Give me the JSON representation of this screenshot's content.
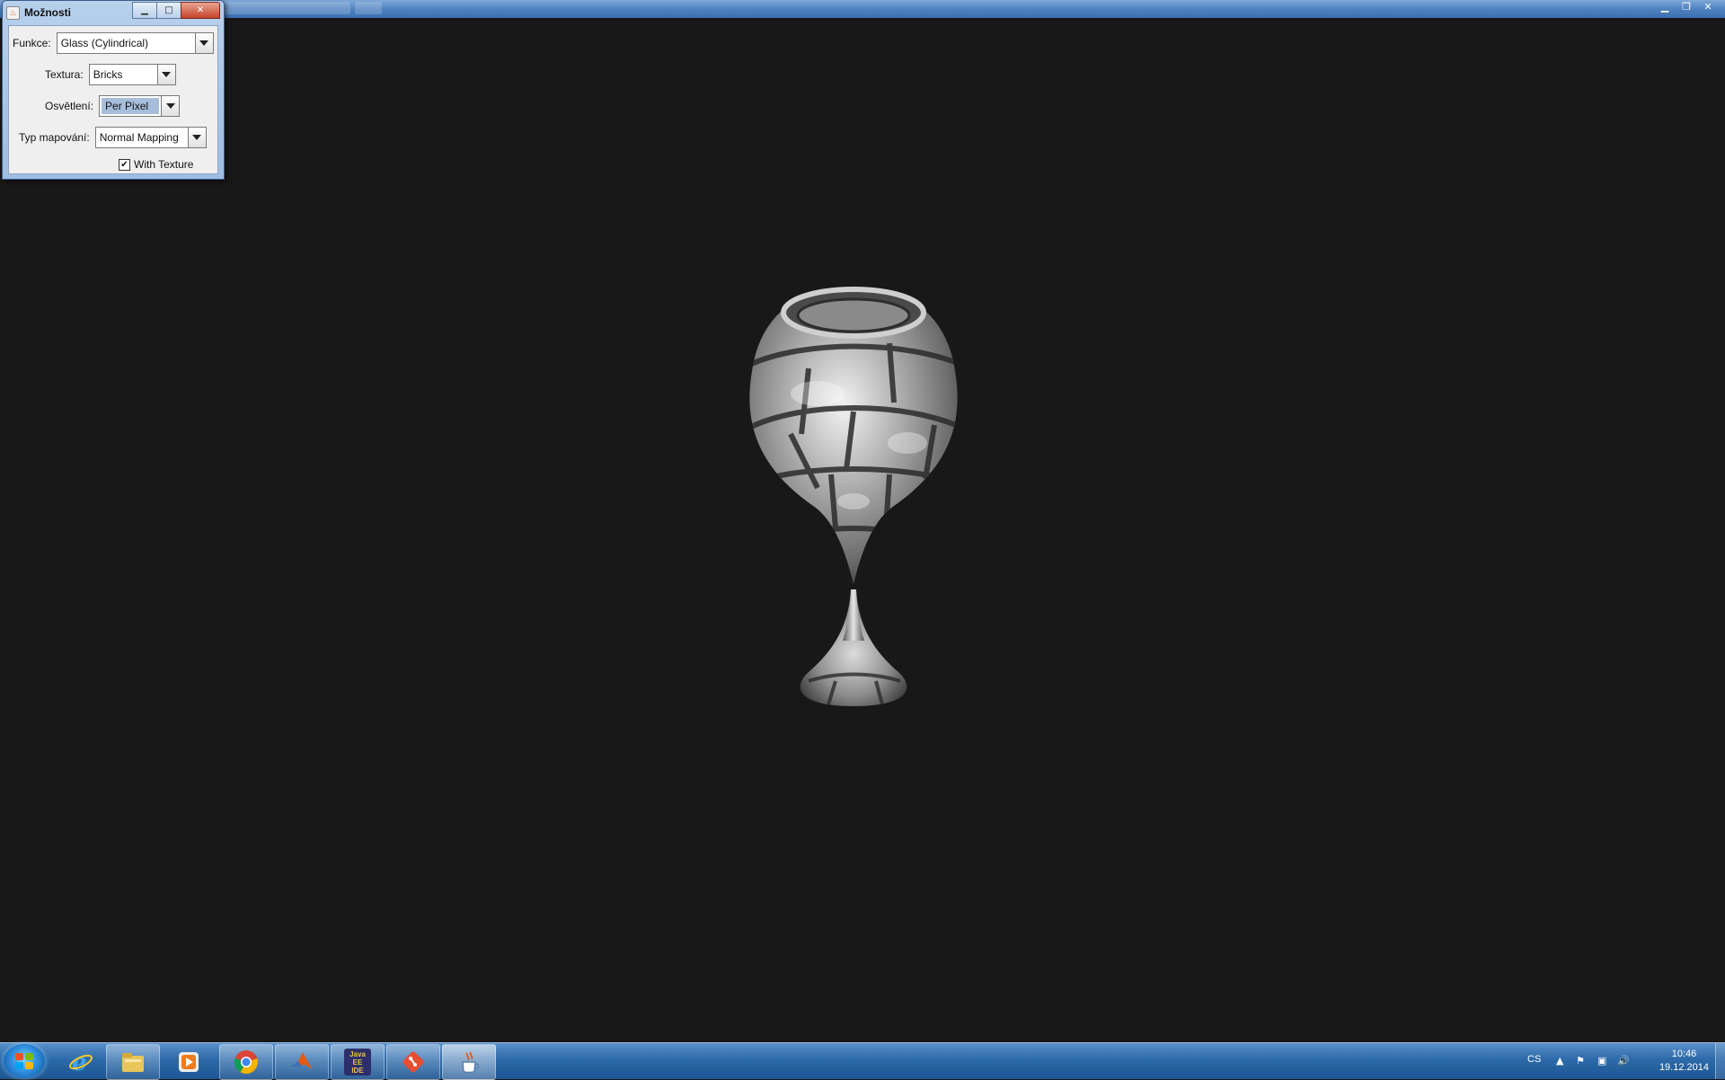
{
  "dialog": {
    "title": "Možnosti",
    "java_icon": "java-icon",
    "controls": {
      "minimize": "▁",
      "maximize": "□",
      "close": "✕"
    },
    "fields": {
      "function": {
        "label": "Funkce:",
        "value": "Glass (Cylindrical)"
      },
      "texture": {
        "label": "Textura:",
        "value": "Bricks"
      },
      "lighting": {
        "label": "Osvětlení:",
        "value": "Per Pixel"
      },
      "mapping": {
        "label": "Typ mapování:",
        "value": "Normal Mapping"
      }
    },
    "with_texture": {
      "label": "With Texture",
      "checked": true,
      "mark": "✔"
    }
  },
  "main_window": {
    "controls": {
      "minimize": "▁",
      "maximize": "❐",
      "close": "✕"
    }
  },
  "scene": {
    "object": "glass-cylindrical-bricks",
    "background": "#181818"
  },
  "taskbar": {
    "pinned": [
      "start-button",
      "internet-explorer-icon",
      "file-explorer-icon",
      "media-player-icon",
      "chrome-icon",
      "matlab-icon",
      "java-ee-ide-icon",
      "git-icon",
      "java-app-icon"
    ],
    "java_ee_label": "Java EE IDE",
    "tray": {
      "language": "CS",
      "time": "10:46",
      "date": "19.12.2014"
    }
  }
}
